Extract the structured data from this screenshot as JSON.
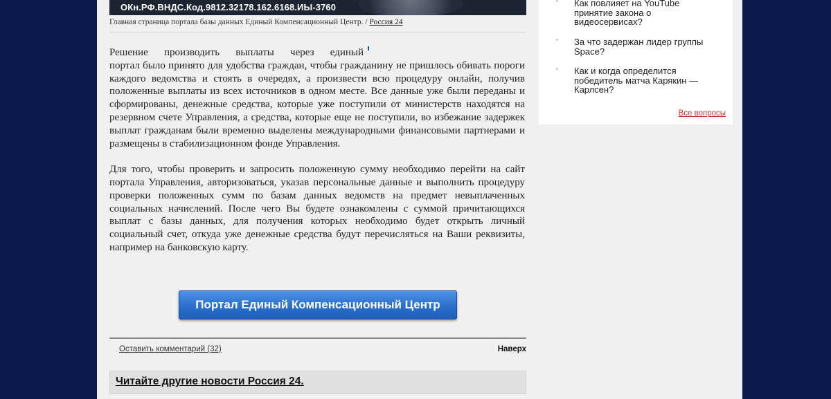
{
  "image": {
    "overlay_text": "ОКн.РФ.ВНДС.Код.9812.32178.162.6168.ИЫ-3760"
  },
  "caption": {
    "text": "Главная страница портала базы данных Единый Компенсационный Центр. / ",
    "source_link": "Россия 24"
  },
  "article": {
    "p1_line1": "Решение производить выплаты через единый",
    "p1_rest": "портал было принято для удобства граждан, чтобы гражданину не пришлось обивать пороги каждого ведомства и стоять в очередях, а произвести всю процедуру онлайн, получив положенные выплаты из всех источников в одном месте. Все данные уже были переданы и сформированы, денежные средства, которые уже поступили от министерств находятся на резервном счете Управления, а средства, которые еще не поступили, во избежание задержек выплат гражданам были временно выделены международными финансовыми партнерами и размещены в стабилизационном фонде Управления.",
    "p2": "Для того, чтобы проверить и запросить положенную сумму необходимо перейти на сайт портала Управления, авторизоваться, указав персональные данные и выполнить процедуру проверки положенных сумм по базам данных ведомств на предмет невыплаченных социальных начислений. После чего Вы будете ознакомлены с суммой причитающихся выплат с базы данных, для получения которых необходимо будет открыть личный социальный счет, откуда уже денежные средства будут перечисляться на Ваши реквизиты, например на банковскую карту."
  },
  "cta": {
    "label": "Портал Единый Компенсационный Центр"
  },
  "footer": {
    "comments_label": "Оставить комментарий (32)",
    "top_label": "Наверх"
  },
  "more_news": {
    "label": "Читайте другие новости Россия 24."
  },
  "sidebar": {
    "questions": [
      "Как повлияет на YouTube принятие закона о видеосервисах?",
      "За что задержан лидер группы Space?",
      "Как и когда определится победитель матча Карякин — Карлсен?"
    ],
    "all_questions_label": "Все вопросы"
  }
}
